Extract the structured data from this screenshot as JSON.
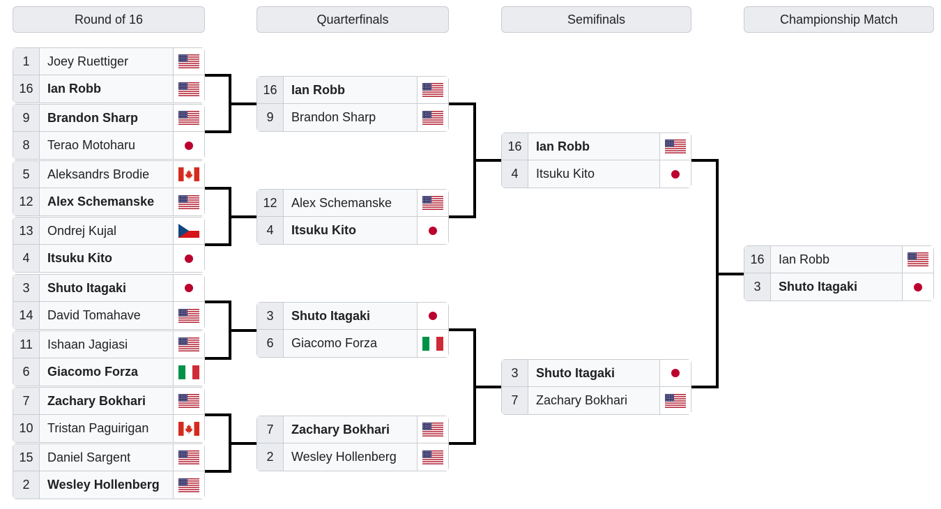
{
  "rounds": [
    "Round of 16",
    "Quarterfinals",
    "Semifinals",
    "Championship Match"
  ],
  "colors": {
    "usa_red": "#b22234",
    "usa_blue": "#3c3b6e",
    "japan_red": "#bc002d",
    "canada_red": "#d52b1e",
    "italy_green": "#009246",
    "italy_red": "#ce2b37",
    "czech_blue": "#11457e",
    "czech_red": "#d7141a"
  },
  "round_of_16": [
    {
      "seed": "1",
      "name": "Joey Ruettiger",
      "flag": "usa-flag-icon",
      "winner": false
    },
    {
      "seed": "16",
      "name": "Ian Robb",
      "flag": "usa-flag-icon",
      "winner": true
    },
    {
      "seed": "9",
      "name": "Brandon Sharp",
      "flag": "usa-flag-icon",
      "winner": true
    },
    {
      "seed": "8",
      "name": "Terao Motoharu",
      "flag": "japan-flag-icon",
      "winner": false
    },
    {
      "seed": "5",
      "name": "Aleksandrs Brodie",
      "flag": "canada-flag-icon",
      "winner": false
    },
    {
      "seed": "12",
      "name": "Alex Schemanske",
      "flag": "usa-flag-icon",
      "winner": true
    },
    {
      "seed": "13",
      "name": "Ondrej Kujal",
      "flag": "czech-flag-icon",
      "winner": false
    },
    {
      "seed": "4",
      "name": "Itsuku Kito",
      "flag": "japan-flag-icon",
      "winner": true
    },
    {
      "seed": "3",
      "name": "Shuto Itagaki",
      "flag": "japan-flag-icon",
      "winner": true
    },
    {
      "seed": "14",
      "name": "David Tomahave",
      "flag": "usa-flag-icon",
      "winner": false
    },
    {
      "seed": "11",
      "name": "Ishaan Jagiasi",
      "flag": "usa-flag-icon",
      "winner": false
    },
    {
      "seed": "6",
      "name": "Giacomo Forza",
      "flag": "italy-flag-icon",
      "winner": true
    },
    {
      "seed": "7",
      "name": "Zachary Bokhari",
      "flag": "usa-flag-icon",
      "winner": true
    },
    {
      "seed": "10",
      "name": "Tristan Paguirigan",
      "flag": "canada-flag-icon",
      "winner": false
    },
    {
      "seed": "15",
      "name": "Daniel Sargent",
      "flag": "usa-flag-icon",
      "winner": false
    },
    {
      "seed": "2",
      "name": "Wesley Hollenberg",
      "flag": "usa-flag-icon",
      "winner": true
    }
  ],
  "quarterfinals": [
    {
      "seed": "16",
      "name": "Ian Robb",
      "flag": "usa-flag-icon",
      "winner": true
    },
    {
      "seed": "9",
      "name": "Brandon Sharp",
      "flag": "usa-flag-icon",
      "winner": false
    },
    {
      "seed": "12",
      "name": "Alex Schemanske",
      "flag": "usa-flag-icon",
      "winner": false
    },
    {
      "seed": "4",
      "name": "Itsuku Kito",
      "flag": "japan-flag-icon",
      "winner": true
    },
    {
      "seed": "3",
      "name": "Shuto Itagaki",
      "flag": "japan-flag-icon",
      "winner": true
    },
    {
      "seed": "6",
      "name": "Giacomo Forza",
      "flag": "italy-flag-icon",
      "winner": false
    },
    {
      "seed": "7",
      "name": "Zachary Bokhari",
      "flag": "usa-flag-icon",
      "winner": true
    },
    {
      "seed": "2",
      "name": "Wesley Hollenberg",
      "flag": "usa-flag-icon",
      "winner": false
    }
  ],
  "semifinals": [
    {
      "seed": "16",
      "name": "Ian Robb",
      "flag": "usa-flag-icon",
      "winner": true
    },
    {
      "seed": "4",
      "name": "Itsuku Kito",
      "flag": "japan-flag-icon",
      "winner": false
    },
    {
      "seed": "3",
      "name": "Shuto Itagaki",
      "flag": "japan-flag-icon",
      "winner": true
    },
    {
      "seed": "7",
      "name": "Zachary Bokhari",
      "flag": "usa-flag-icon",
      "winner": false
    }
  ],
  "championship": [
    {
      "seed": "16",
      "name": "Ian Robb",
      "flag": "usa-flag-icon",
      "winner": false
    },
    {
      "seed": "3",
      "name": "Shuto Itagaki",
      "flag": "japan-flag-icon",
      "winner": true
    }
  ]
}
